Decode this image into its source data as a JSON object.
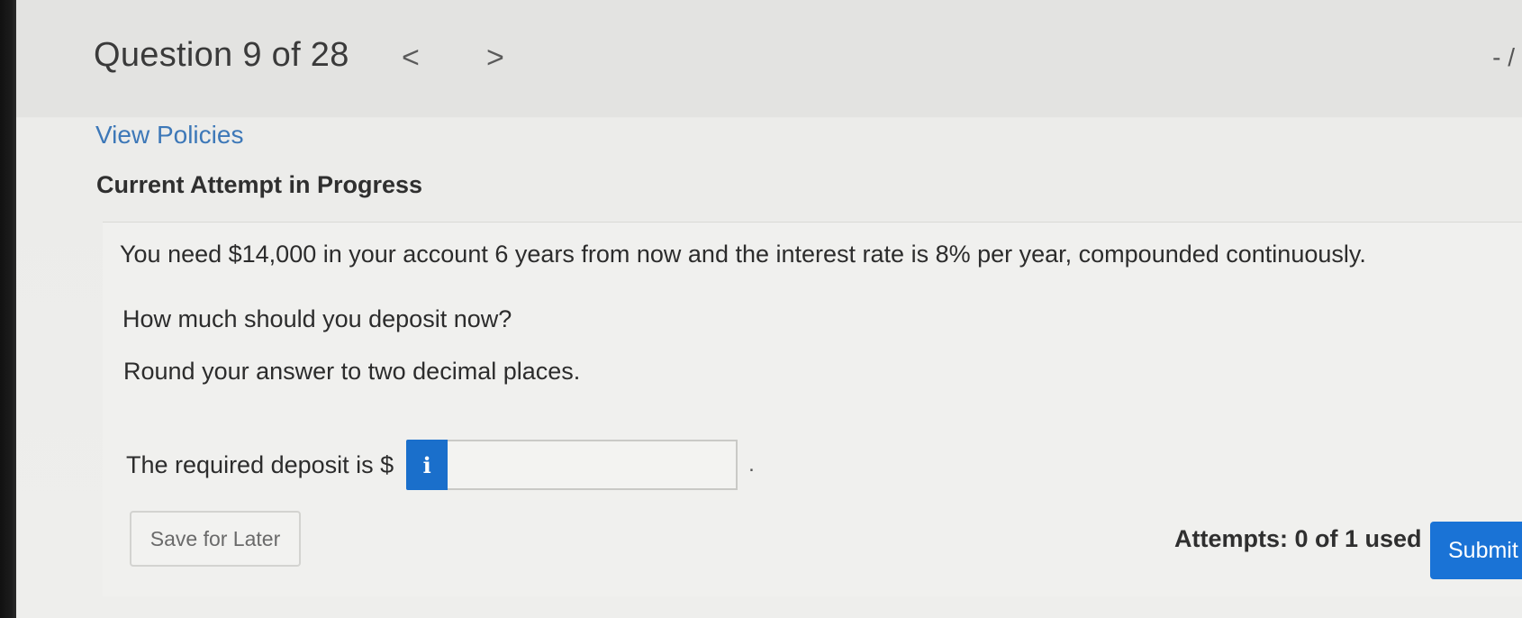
{
  "header": {
    "question_counter": "Question 9 of 28",
    "prev_glyph": "<",
    "next_glyph": ">",
    "corner_text": "- /"
  },
  "links": {
    "view_policies": "View Policies"
  },
  "status": {
    "heading": "Current Attempt in Progress"
  },
  "question": {
    "line1": "You need $14,000 in your account 6 years from now and the interest rate is 8% per year, compounded continuously.",
    "line2": "How much should you deposit now?",
    "line3": "Round your answer to two decimal places."
  },
  "answer": {
    "label": "The required deposit is $",
    "info_icon": "i",
    "value": "",
    "trailing": "."
  },
  "footer": {
    "save_label": "Save for Later",
    "attempts": "Attempts: 0 of 1 used",
    "submit_label": "Submit A"
  },
  "colors": {
    "link": "#3d78b8",
    "primary": "#1a73d6",
    "info_badge": "#1a6fcb"
  }
}
